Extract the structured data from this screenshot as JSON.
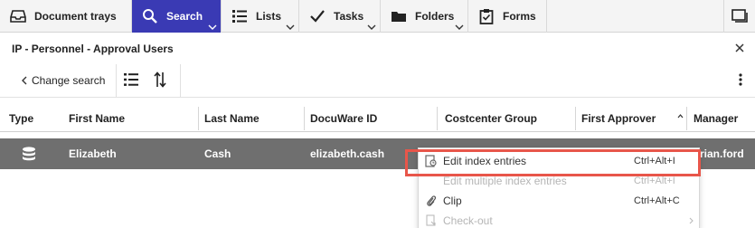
{
  "nav": {
    "trays": "Document trays",
    "search": "Search",
    "lists": "Lists",
    "tasks": "Tasks",
    "folders": "Folders",
    "forms": "Forms"
  },
  "result": {
    "title": "IP - Personnel - Approval Users",
    "change_search": "Change search"
  },
  "table": {
    "columns": [
      "Type",
      "First Name",
      "Last Name",
      "DocuWare ID",
      "Costcenter Group",
      "First Approver",
      "Manager"
    ],
    "rows": [
      {
        "first_name": "Elizabeth",
        "last_name": "Cash",
        "docuware_id": "elizabeth.cash",
        "manager": "rian.ford"
      }
    ]
  },
  "context_menu": {
    "items": [
      {
        "label": "Edit index entries",
        "shortcut": "Ctrl+Alt+I",
        "enabled": true
      },
      {
        "label": "Edit multiple index entries",
        "shortcut": "Ctrl+Alt+I",
        "enabled": false
      },
      {
        "label": "Clip",
        "shortcut": "Ctrl+Alt+C",
        "enabled": true
      },
      {
        "label": "Check-out",
        "shortcut": "",
        "enabled": false
      }
    ]
  },
  "colors": {
    "active_nav": "#3a3ab4",
    "selected_row": "#6f6f6f",
    "highlight": "#e8564a"
  },
  "icons": {
    "trays": "tray-icon",
    "search": "search-icon",
    "lists": "list-icon",
    "tasks": "checkmark-icon",
    "folders": "folder-icon",
    "forms": "clipboard-icon",
    "window": "window-icon"
  }
}
